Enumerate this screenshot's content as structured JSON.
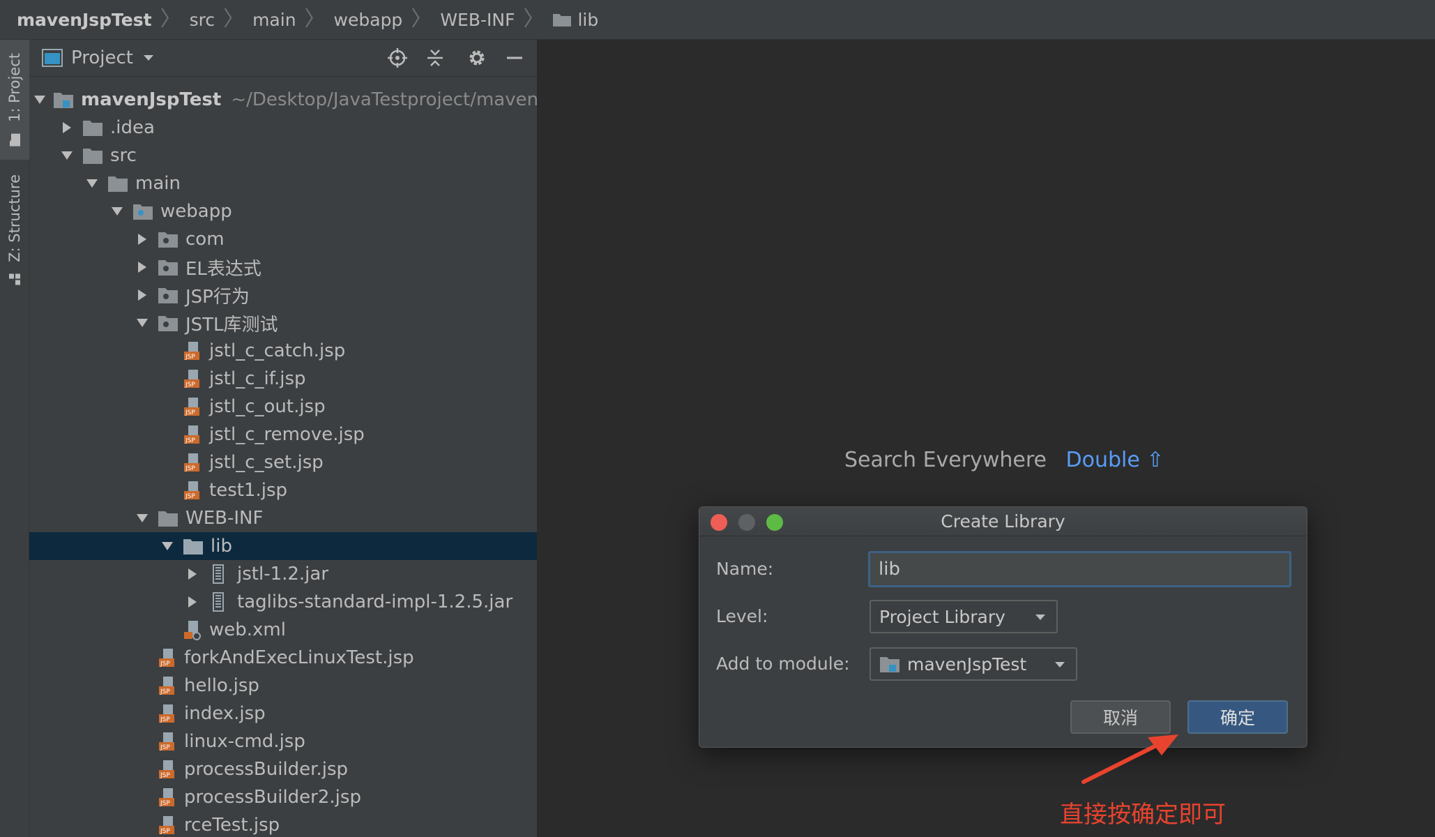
{
  "breadcrumb": {
    "items": [
      "mavenJspTest",
      "src",
      "main",
      "webapp",
      "WEB-INF",
      "lib"
    ]
  },
  "toolstrip": {
    "project_tab": "1: Project",
    "structure_tab": "Z: Structure"
  },
  "project_panel": {
    "title": "Project",
    "tree": [
      {
        "label": "mavenJspTest",
        "hint": "~/Desktop/JavaTestproject/mavenJ",
        "icon": "module-folder-icon",
        "expanded": true
      },
      {
        "label": ".idea",
        "icon": "folder-icon",
        "expanded": false
      },
      {
        "label": "src",
        "icon": "folder-icon",
        "expanded": true
      },
      {
        "label": "main",
        "icon": "folder-icon",
        "expanded": true
      },
      {
        "label": "webapp",
        "icon": "web-folder-icon",
        "expanded": true
      },
      {
        "label": "com",
        "icon": "web-folder-icon",
        "expanded": false
      },
      {
        "label": "EL表达式",
        "icon": "web-folder-icon",
        "expanded": false
      },
      {
        "label": "JSP行为",
        "icon": "web-folder-icon",
        "expanded": false
      },
      {
        "label": "JSTL库测试",
        "icon": "web-folder-icon",
        "expanded": true
      },
      {
        "label": "jstl_c_catch.jsp",
        "icon": "jsp-file-icon"
      },
      {
        "label": "jstl_c_if.jsp",
        "icon": "jsp-file-icon"
      },
      {
        "label": "jstl_c_out.jsp",
        "icon": "jsp-file-icon"
      },
      {
        "label": "jstl_c_remove.jsp",
        "icon": "jsp-file-icon"
      },
      {
        "label": "jstl_c_set.jsp",
        "icon": "jsp-file-icon"
      },
      {
        "label": "test1.jsp",
        "icon": "jsp-file-icon"
      },
      {
        "label": "WEB-INF",
        "icon": "folder-icon",
        "expanded": true
      },
      {
        "label": "lib",
        "icon": "folder-icon",
        "expanded": true,
        "selected": true
      },
      {
        "label": "jstl-1.2.jar",
        "icon": "jar-icon",
        "expanded": false
      },
      {
        "label": "taglibs-standard-impl-1.2.5.jar",
        "icon": "jar-icon",
        "expanded": false
      },
      {
        "label": "web.xml",
        "icon": "xml-file-icon"
      },
      {
        "label": "forkAndExecLinuxTest.jsp",
        "icon": "jsp-file-icon"
      },
      {
        "label": "hello.jsp",
        "icon": "jsp-file-icon"
      },
      {
        "label": "index.jsp",
        "icon": "jsp-file-icon"
      },
      {
        "label": "linux-cmd.jsp",
        "icon": "jsp-file-icon"
      },
      {
        "label": "processBuilder.jsp",
        "icon": "jsp-file-icon"
      },
      {
        "label": "processBuilder2.jsp",
        "icon": "jsp-file-icon"
      },
      {
        "label": "rceTest.jsp",
        "icon": "jsp-file-icon"
      }
    ]
  },
  "editor": {
    "search_label": "Search Everywhere",
    "search_key": "Double ⇧"
  },
  "dialog": {
    "title": "Create Library",
    "name_label": "Name:",
    "name_value": "lib",
    "level_label": "Level:",
    "level_value": "Project Library",
    "module_label": "Add to module:",
    "module_value": "mavenJspTest",
    "cancel_label": "取消",
    "ok_label": "确定"
  },
  "annotation": {
    "text": "直接按确定即可",
    "color": "#e8432e"
  },
  "colors": {
    "selection": "#0d293e",
    "accent_blue": "#589df6",
    "ok_button": "#365880"
  }
}
